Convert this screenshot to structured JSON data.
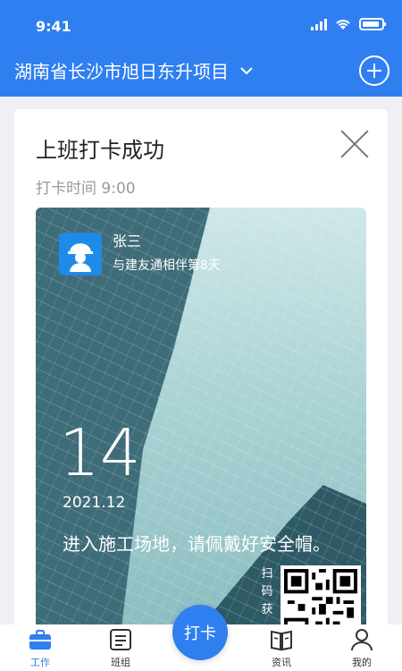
{
  "status_bar": {
    "time": "9:41"
  },
  "header": {
    "project_name": "湖南省长沙市旭日东升项目"
  },
  "card": {
    "title": "上班打卡成功",
    "checkin_time": "打卡时间 9:00",
    "photo": {
      "name": "张三",
      "days_text": "与建友通相伴第8天",
      "day": "14",
      "year_month": "2021.12",
      "quote": "进入施工场地，请佩戴好安全帽。",
      "qr_hint": "扫码获"
    }
  },
  "tabbar": {
    "items": [
      {
        "label": "工作",
        "icon": "briefcase-icon",
        "active": true
      },
      {
        "label": "班组",
        "icon": "team-list-icon",
        "active": false
      },
      {
        "label": "资讯",
        "icon": "news-icon",
        "active": false
      },
      {
        "label": "我的",
        "icon": "profile-icon",
        "active": false
      }
    ],
    "center_label": "打卡"
  },
  "colors": {
    "accent": "#2f7ff0",
    "tab_active": "#2f7ff0"
  }
}
